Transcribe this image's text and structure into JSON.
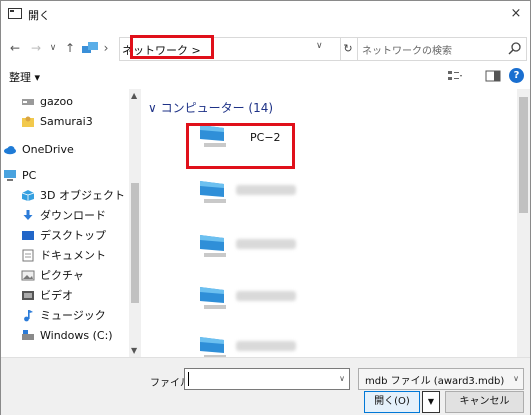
{
  "window": {
    "title": "開く",
    "close_glyph": "×"
  },
  "address": {
    "breadcrumb": "ネットワーク  >",
    "dropdown_glyph": "∨",
    "refresh_glyph": "↻"
  },
  "nav_buttons": {
    "back": "←",
    "forward": "→",
    "recent": "∨",
    "up": "↑",
    "sep": "›"
  },
  "search": {
    "placeholder": "ネットワークの検索"
  },
  "toolbar": {
    "organize": "整理 ▾"
  },
  "sidebar": {
    "items": [
      {
        "label": "gazoo",
        "icon": "drive-icon"
      },
      {
        "label": "Samurai3",
        "icon": "user-folder-icon"
      },
      {
        "label": "OneDrive",
        "icon": "onedrive-icon"
      },
      {
        "label": "PC",
        "icon": "pc-icon"
      },
      {
        "label": "3D オブジェクト",
        "icon": "3d-objects-icon"
      },
      {
        "label": "ダウンロード",
        "icon": "downloads-icon"
      },
      {
        "label": "デスクトップ",
        "icon": "desktop-icon"
      },
      {
        "label": "ドキュメント",
        "icon": "documents-icon"
      },
      {
        "label": "ピクチャ",
        "icon": "pictures-icon"
      },
      {
        "label": "ビデオ",
        "icon": "videos-icon"
      },
      {
        "label": "ミュージック",
        "icon": "music-icon"
      },
      {
        "label": "Windows (C:)",
        "icon": "drive-c-icon"
      }
    ]
  },
  "content": {
    "group_header": "∨  コンピューター (14)",
    "computers": [
      {
        "name": "PC−2"
      }
    ]
  },
  "footer": {
    "filename_label": "ファイル名(N):",
    "filename_value": "",
    "filter": "mdb ファイル (award3.mdb)",
    "open_button": "開く(O)",
    "cancel_button": "キャンセル"
  },
  "colors": {
    "highlight_red": "#e0101a",
    "accent_blue": "#0078d7",
    "group_header_blue": "#1e3287"
  }
}
